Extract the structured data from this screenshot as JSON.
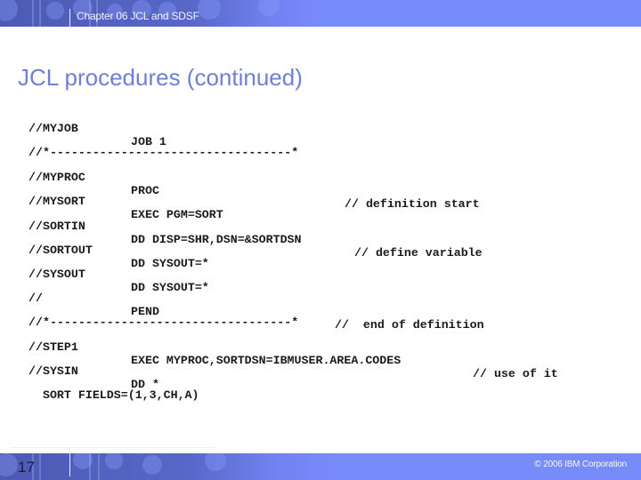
{
  "header": {
    "chapter_title": "Chapter 06 JCL and SDSF"
  },
  "slide": {
    "title": "JCL procedures (continued)"
  },
  "code_lines": [
    {
      "name": "//MYJOB",
      "op": "JOB 1",
      "comment": ""
    },
    {
      "name": "//*----------------------------------*",
      "op": "",
      "comment": ""
    },
    {
      "name": "//MYPROC",
      "op": "PROC",
      "comment": "// definition start"
    },
    {
      "name": "//MYSORT",
      "op": "EXEC PGM=SORT",
      "comment": ""
    },
    {
      "name": "//SORTIN",
      "op": "DD DISP=SHR,DSN=&SORTDSN",
      "comment": "// define variable"
    },
    {
      "name": "//SORTOUT",
      "op": "DD SYSOUT=*",
      "comment": ""
    },
    {
      "name": "//SYSOUT",
      "op": "DD SYSOUT=*",
      "comment": ""
    },
    {
      "name": "//",
      "op": "PEND",
      "comment": "//  end of definition"
    },
    {
      "name": "//*----------------------------------*",
      "op": "",
      "comment": ""
    },
    {
      "name": "//STEP1",
      "op": "EXEC MYPROC,SORTDSN=IBMUSER.AREA.CODES",
      "comment": "// use of it"
    },
    {
      "name": "//SYSIN",
      "op": "DD *",
      "comment": ""
    },
    {
      "name": "  SORT FIELDS=(1,3,CH,A)",
      "op": "",
      "comment": ""
    }
  ],
  "footer": {
    "page_number": "17",
    "copyright": "© 2006 IBM Corporation"
  },
  "colors": {
    "banner": "#788bfb",
    "title": "#6f7fd6",
    "code_text": "#1a1a1a"
  }
}
